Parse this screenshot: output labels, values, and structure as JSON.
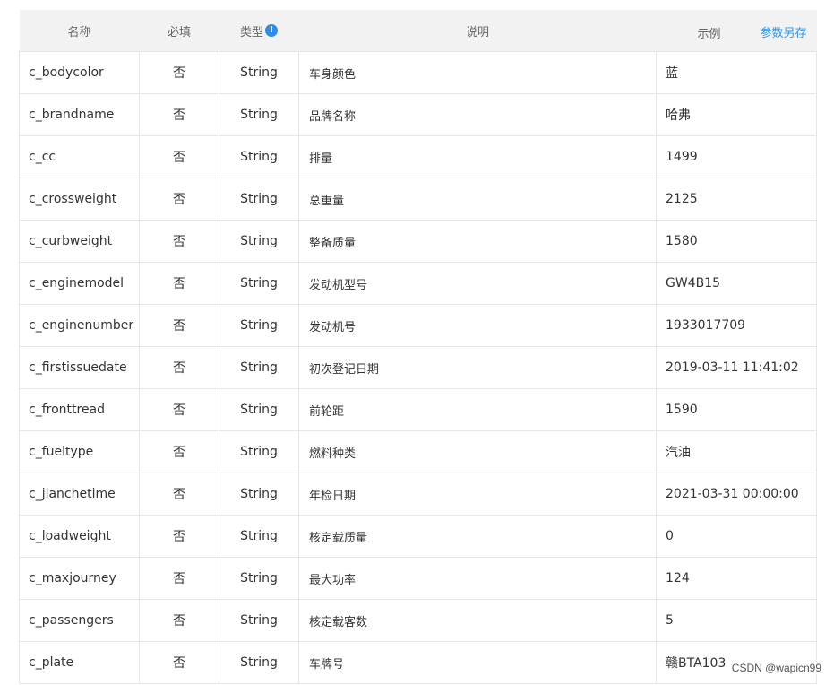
{
  "table": {
    "headers": {
      "name": "名称",
      "required": "必填",
      "type": "类型",
      "type_info_icon": "!",
      "description": "说明",
      "example": "示例",
      "save_link": "参数另存"
    },
    "rows": [
      {
        "name": "c_bodycolor",
        "required": "否",
        "type": "String",
        "description": "车身颜色",
        "example": "蓝"
      },
      {
        "name": "c_brandname",
        "required": "否",
        "type": "String",
        "description": "品牌名称",
        "example": "哈弗"
      },
      {
        "name": "c_cc",
        "required": "否",
        "type": "String",
        "description": "排量",
        "example": "1499"
      },
      {
        "name": "c_crossweight",
        "required": "否",
        "type": "String",
        "description": "总重量",
        "example": "2125"
      },
      {
        "name": "c_curbweight",
        "required": "否",
        "type": "String",
        "description": "整备质量",
        "example": "1580"
      },
      {
        "name": "c_enginemodel",
        "required": "否",
        "type": "String",
        "description": "发动机型号",
        "example": "GW4B15"
      },
      {
        "name": "c_enginenumber",
        "required": "否",
        "type": "String",
        "description": "发动机号",
        "example": "1933017709"
      },
      {
        "name": "c_firstissuedate",
        "required": "否",
        "type": "String",
        "description": "初次登记日期",
        "example": "2019-03-11 11:41:02"
      },
      {
        "name": "c_fronttread",
        "required": "否",
        "type": "String",
        "description": "前轮距",
        "example": "1590"
      },
      {
        "name": "c_fueltype",
        "required": "否",
        "type": "String",
        "description": "燃料种类",
        "example": "汽油"
      },
      {
        "name": "c_jianchetime",
        "required": "否",
        "type": "String",
        "description": "年检日期",
        "example": "2021-03-31 00:00:00"
      },
      {
        "name": "c_loadweight",
        "required": "否",
        "type": "String",
        "description": "核定载质量",
        "example": "0"
      },
      {
        "name": "c_maxjourney",
        "required": "否",
        "type": "String",
        "description": "最大功率",
        "example": "124"
      },
      {
        "name": "c_passengers",
        "required": "否",
        "type": "String",
        "description": "核定载客数",
        "example": "5"
      },
      {
        "name": "c_plate",
        "required": "否",
        "type": "String",
        "description": "车牌号",
        "example": "赣BTA103"
      }
    ]
  },
  "watermark": "CSDN @wapicn99",
  "colors": {
    "header_bg": "#f2f2f2",
    "link": "#2b9af3",
    "info_icon": "#2f8ce8",
    "border": "#e6e6e6"
  }
}
